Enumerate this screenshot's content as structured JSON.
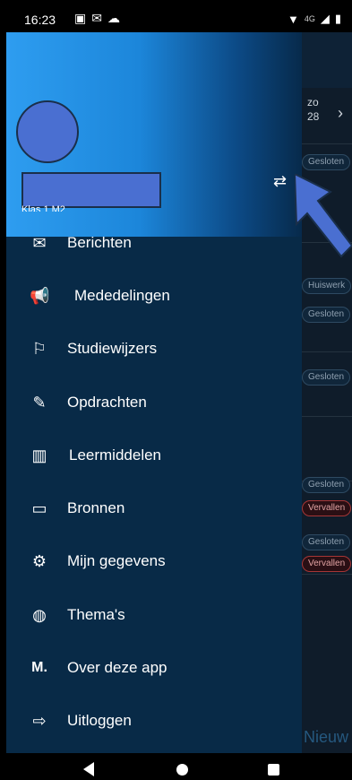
{
  "status": {
    "time": "16:23",
    "left_icons": [
      "notification-icon",
      "notification-icon",
      "cloud-icon"
    ],
    "net": "4G"
  },
  "background": {
    "day": "zo",
    "date": "28",
    "pills": [
      {
        "text": "Gesloten",
        "type": "normal"
      },
      {
        "text": "Huiswerk",
        "type": "normal"
      },
      {
        "text": "Gesloten",
        "type": "normal"
      },
      {
        "text": "Gesloten",
        "type": "normal"
      },
      {
        "text": "Gesloten",
        "type": "normal"
      },
      {
        "text": "Vervallen",
        "type": "red"
      },
      {
        "text": "Gesloten",
        "type": "normal"
      },
      {
        "text": "Vervallen",
        "type": "red"
      }
    ],
    "new_label": "Nieuw"
  },
  "drawer": {
    "subtitle": "Klas 1 M2",
    "switch_icon": "swap-icon",
    "items": [
      {
        "label": "Berichten",
        "icon": "mail-icon",
        "glyph": "✉"
      },
      {
        "label": "Mededelingen",
        "icon": "megaphone-icon",
        "glyph": "📢"
      },
      {
        "label": "Studiewijzers",
        "icon": "signpost-icon",
        "glyph": "⚐"
      },
      {
        "label": "Opdrachten",
        "icon": "pencil-icon",
        "glyph": "✎"
      },
      {
        "label": "Leermiddelen",
        "icon": "books-icon",
        "glyph": "▥"
      },
      {
        "label": "Bronnen",
        "icon": "folder-icon",
        "glyph": "▭"
      },
      {
        "label": "Mijn gegevens",
        "icon": "settings-icon",
        "glyph": "⚙"
      },
      {
        "label": "Thema's",
        "icon": "palette-icon",
        "glyph": "◍"
      },
      {
        "label": "Over deze app",
        "icon": "magister-logo-icon",
        "glyph": "M."
      },
      {
        "label": "Uitloggen",
        "icon": "logout-icon",
        "glyph": "⇨"
      }
    ]
  },
  "colors": {
    "drawer_bg": "#082a47",
    "header_gradient_start": "#2e9df0",
    "annotation_arrow": "#4a6fd1"
  }
}
